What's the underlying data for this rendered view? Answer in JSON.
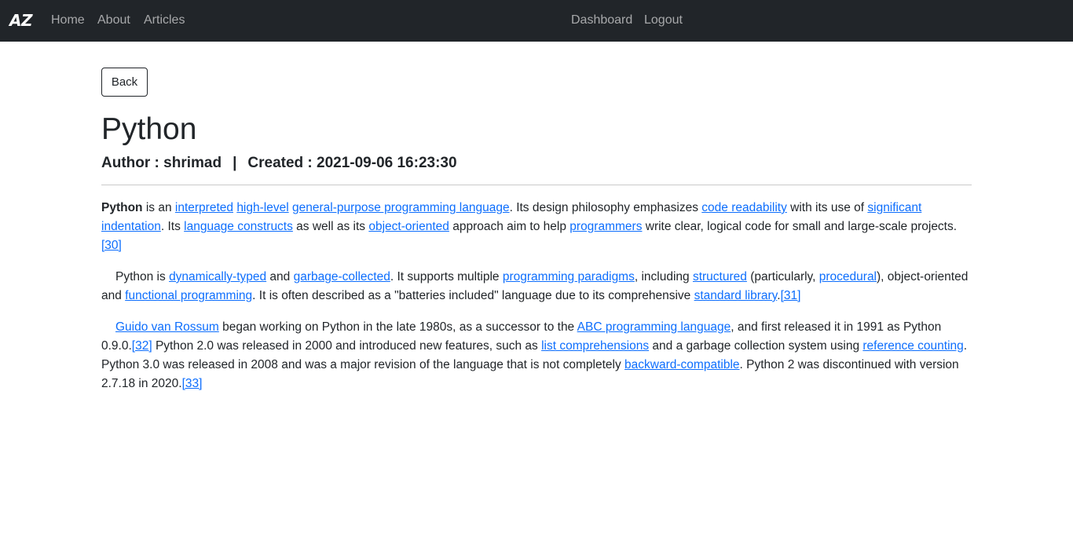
{
  "navbar": {
    "brand": "AZ",
    "links": {
      "home": "Home",
      "about": "About",
      "articles": "Articles",
      "dashboard": "Dashboard",
      "logout": "Logout"
    }
  },
  "back_label": "Back",
  "article": {
    "title": "Python",
    "author_label": "Author : shrimad",
    "separator": "|",
    "created_label": "Created : 2021-09-06 16:23:30",
    "p1": {
      "bold": "Python",
      "t1": " is an ",
      "l1": "interpreted",
      "t2": " ",
      "l2": "high-level",
      "t3": " ",
      "l3": "general-purpose programming language",
      "t4": ". Its design philosophy emphasizes ",
      "l4": "code readability",
      "t5": " with its use of ",
      "l5": "significant indentation",
      "t6": ". Its ",
      "l6": "language constructs",
      "t7": " as well as its ",
      "l7": "object-oriented",
      "t8": " approach aim to help ",
      "l8": "programmers",
      "t9": " write clear, logical code for small and large-scale projects.",
      "ref": "[30]"
    },
    "p2": {
      "t1": "Python is ",
      "l1": "dynamically-typed",
      "t2": " and ",
      "l2": "garbage-collected",
      "t3": ". It supports multiple ",
      "l3": "programming paradigms",
      "t4": ", including ",
      "l4": "structured",
      "t5": " (particularly, ",
      "l5": "procedural",
      "t6": "), object-oriented and ",
      "l6": "functional programming",
      "t7": ". It is often described as a \"batteries included\" language due to its comprehensive ",
      "l7": "standard library",
      "t8": ".",
      "ref": "[31]"
    },
    "p3": {
      "l1": "Guido van Rossum",
      "t1": " began working on Python in the late 1980s, as a successor to the ",
      "l2": "ABC programming language",
      "t2": ", and first released it in 1991 as Python 0.9.0.",
      "ref1": "[32]",
      "t3": " Python 2.0 was released in 2000 and introduced new features, such as ",
      "l3": "list comprehensions",
      "t4": " and a garbage collection system using ",
      "l4": "reference counting",
      "t5": ". Python 3.0 was released in 2008 and was a major revision of the language that is not completely ",
      "l5": "backward-compatible",
      "t6": ". Python 2 was discontinued with version 2.7.18 in 2020.",
      "ref2": "[33]"
    }
  }
}
